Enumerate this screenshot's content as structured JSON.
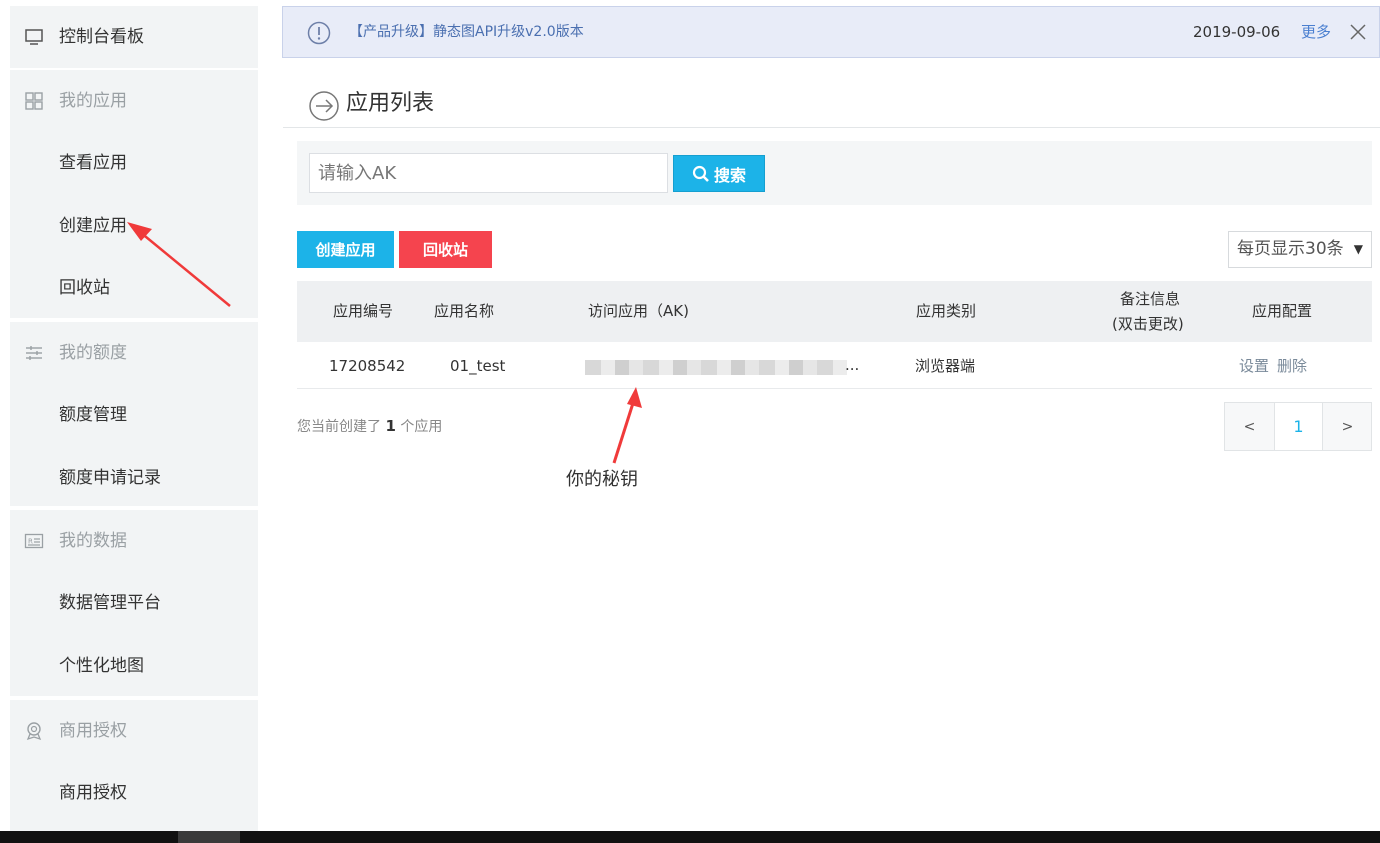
{
  "sidebar": {
    "dashboard": "控制台看板",
    "sections": [
      {
        "header": "我的应用",
        "items": [
          "查看应用",
          "创建应用",
          "回收站"
        ]
      },
      {
        "header": "我的额度",
        "items": [
          "额度管理",
          "额度申请记录"
        ]
      },
      {
        "header": "我的数据",
        "items": [
          "数据管理平台",
          "个性化地图"
        ]
      },
      {
        "header": "商用授权",
        "items": [
          "商用授权"
        ]
      }
    ]
  },
  "notice": {
    "text": "【产品升级】静态图API升级v2.0版本",
    "date": "2019-09-06",
    "more": "更多"
  },
  "page": {
    "title": "应用列表"
  },
  "search": {
    "placeholder": "请输入AK",
    "button": "搜索"
  },
  "actions": {
    "create": "创建应用",
    "recycle": "回收站",
    "per_page": "每页显示30条"
  },
  "table": {
    "headers": [
      "应用编号",
      "应用名称",
      "访问应用（AK)",
      "应用类别",
      "备注信息",
      "(双击更改)",
      "应用配置"
    ],
    "rows": [
      {
        "id": "17208542",
        "name": "01_test",
        "ak_suffix": "...",
        "type": "浏览器端",
        "settings": "设置",
        "delete": "删除"
      }
    ]
  },
  "summary": {
    "prefix": "您当前创建了",
    "count": "1",
    "suffix": "个应用"
  },
  "pagination": {
    "prev": "<",
    "current": "1",
    "next": ">"
  },
  "annotation": {
    "label": "你的秘钥",
    "arrow_color": "#f03a3a"
  },
  "colors": {
    "accent": "#1cb3e8",
    "danger": "#f5444e"
  }
}
